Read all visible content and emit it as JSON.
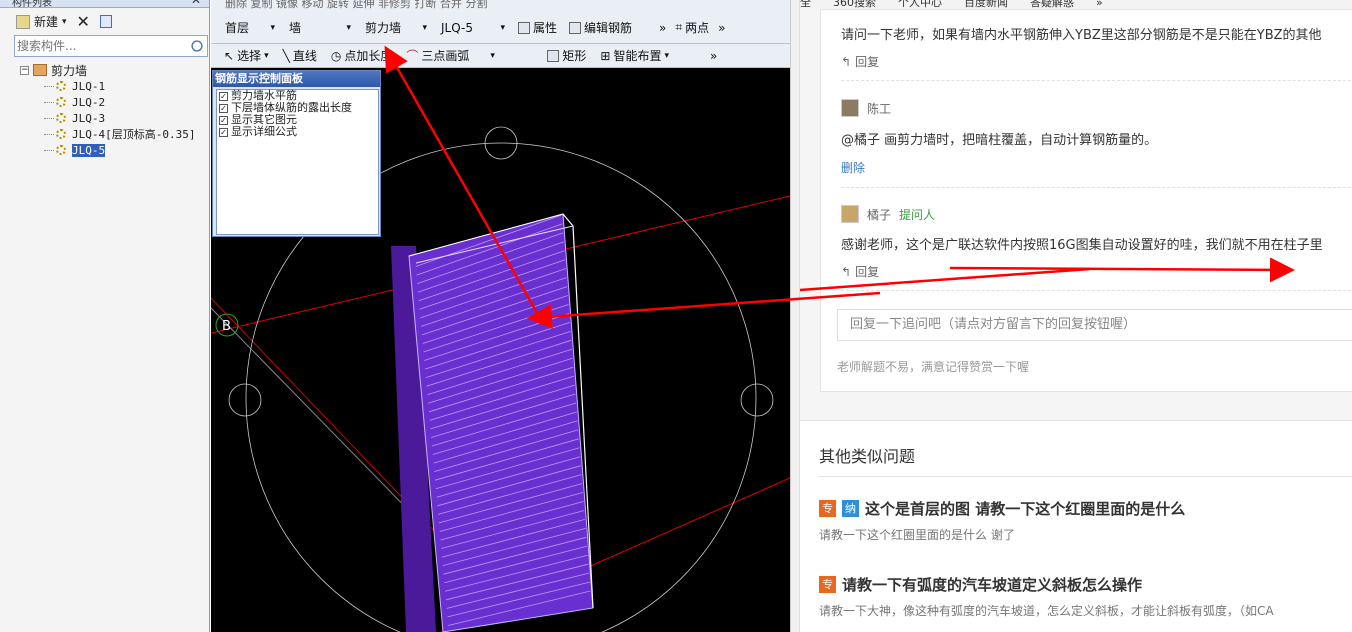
{
  "left_pane": {
    "title": "构件列表",
    "new_label": "新建",
    "search_placeholder": "搜索构件...",
    "tree_root": "剪力墙",
    "tree_items": [
      "JLQ-1",
      "JLQ-2",
      "JLQ-3",
      "JLQ-4[层顶标高-0.35]",
      "JLQ-5"
    ],
    "selected_index": 4
  },
  "cad": {
    "toolbar_top": "删除  复制  镜像  移动  旋转  延伸  非修剪  打断  合并  分割",
    "floor": "首层",
    "category": "墙",
    "type": "剪力墙",
    "element": "JLQ-5",
    "properties_label": "属性",
    "edit_rebar_label": "编辑钢筋",
    "two_points_label": "两点",
    "select_label": "选择",
    "line_label": "直线",
    "add_length_label": "点加长度",
    "arc_label": "三点画弧",
    "rect_label": "矩形",
    "smart_layout_label": "智能布置",
    "panel_title": "钢筋显示控制面板",
    "panel_options": [
      "剪力墙水平筋",
      "下层墙体纵筋的露出长度",
      "显示其它图元",
      "显示详细公式"
    ],
    "axis_label": "B"
  },
  "web": {
    "bookmarks": [
      "全",
      "360搜索",
      "个人中心",
      "百度新闻",
      "答疑解惑",
      "»"
    ],
    "question_text": "请问一下老师，如果有墙内水平钢筋伸入YBZ里这部分钢筋是不是只能在YBZ的其他",
    "reply_label": "回复",
    "teacher_name": "陈工",
    "teacher_answer": "@橘子 画剪力墙时，把暗柱覆盖，自动计算钢筋量的。",
    "delete_label": "删除",
    "asker_name": "橘子",
    "asker_tag": "提问人",
    "asker_text": "感谢老师，这个是广联达软件内按照16G图集自动设置好的哇，我们就不用在柱子里",
    "followup_placeholder": "回复一下追问吧（请点对方留言下的回复按钮喔）",
    "hint": "老师解题不易，满意记得赞赏一下喔",
    "similar_title": "其他类似问题",
    "similar": [
      {
        "badges": [
          "专",
          "纳"
        ],
        "title": "这个是首层的图 请教一下这个红圈里面的是什么",
        "desc": "请教一下这个红圈里面的是什么  谢了"
      },
      {
        "badges": [
          "专"
        ],
        "title": "请教一下有弧度的汽车坡道定义斜板怎么操作",
        "desc": "请教一下大神，像这种有弧度的汽车坡道，怎么定义斜板，才能让斜板有弧度，（如CA"
      }
    ]
  },
  "colors": {
    "annotation": "#ff0000",
    "wall": "#6a2fd0",
    "selection": "#2f5fb8",
    "accent_green": "#3aa040"
  }
}
